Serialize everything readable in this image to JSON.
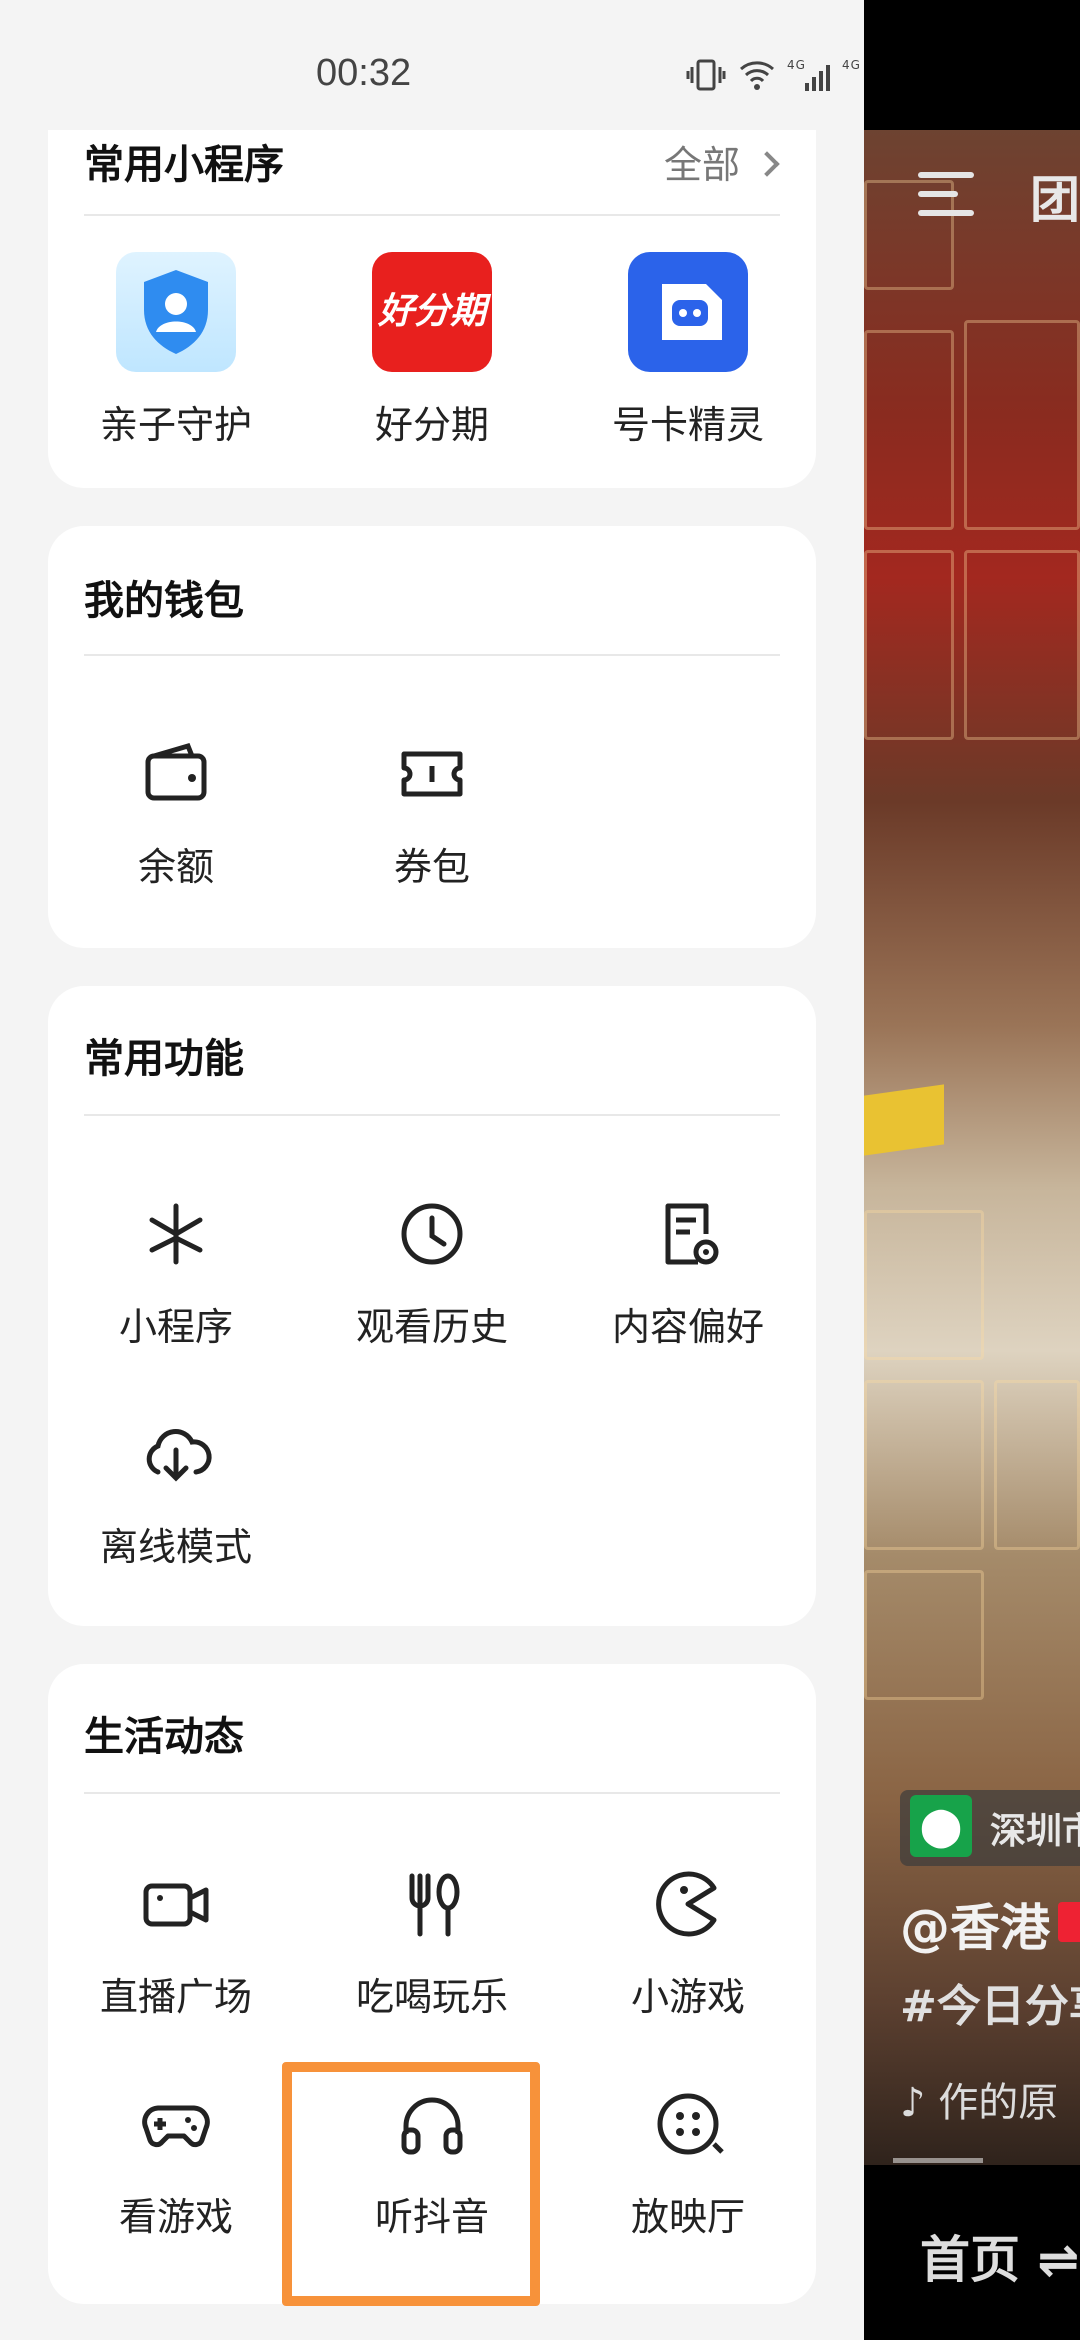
{
  "status_bar": {
    "time": "00:32",
    "icons": "▯ ◉ 4G ⁞ 4G ⁞"
  },
  "mini_programs": {
    "title": "常用小程序",
    "more_label": "全部",
    "items": [
      {
        "label": "亲子守护",
        "icon": "shield-user-icon"
      },
      {
        "label": "好分期",
        "icon": "haofenqi-logo",
        "logo_text": "好分期"
      },
      {
        "label": "号卡精灵",
        "icon": "robot-card-icon"
      }
    ]
  },
  "wallet": {
    "title": "我的钱包",
    "items": [
      {
        "label": "余额",
        "icon": "wallet-icon"
      },
      {
        "label": "券包",
        "icon": "ticket-icon"
      }
    ]
  },
  "features": {
    "title": "常用功能",
    "items": [
      {
        "label": "小程序",
        "icon": "asterisk-icon"
      },
      {
        "label": "观看历史",
        "icon": "clock-icon"
      },
      {
        "label": "内容偏好",
        "icon": "doc-settings-icon"
      },
      {
        "label": "离线模式",
        "icon": "cloud-download-icon"
      }
    ]
  },
  "life": {
    "title": "生活动态",
    "items": [
      {
        "label": "直播广场",
        "icon": "video-camera-icon"
      },
      {
        "label": "吃喝玩乐",
        "icon": "fork-spoon-icon"
      },
      {
        "label": "小游戏",
        "icon": "pacman-icon"
      },
      {
        "label": "看游戏",
        "icon": "gamepad-icon"
      },
      {
        "label": "听抖音",
        "icon": "headphones-icon"
      },
      {
        "label": "放映厅",
        "icon": "film-reel-icon"
      }
    ]
  },
  "video": {
    "top_tab": "团",
    "location": "深圳市",
    "author": "@香港",
    "hashtag": "#今日分享",
    "music": "♪ 作的原",
    "bottom_tab": "首页 ⇌"
  },
  "colors": {
    "highlight": "#f7923a",
    "card_bg": "#ffffff",
    "drawer_bg": "#f4f4f4"
  }
}
